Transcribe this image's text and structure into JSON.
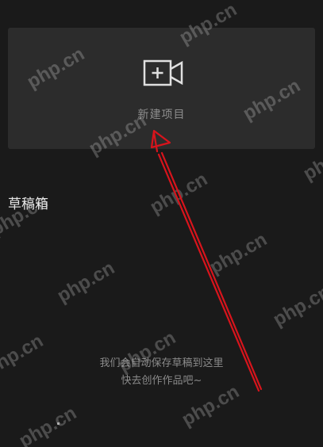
{
  "new_project": {
    "label": "新建项目",
    "icon": "video-camera-plus-icon"
  },
  "drafts": {
    "title": "草稿箱",
    "empty_line_1": "我们会自动保存草稿到这里",
    "empty_line_2": "快去创作作品吧~"
  },
  "watermark": {
    "text": "php.cn"
  },
  "annotation": {
    "arrow_color": "#d8141c"
  },
  "colors": {
    "background": "#1a1a1a",
    "card": "#2c2c2c"
  }
}
